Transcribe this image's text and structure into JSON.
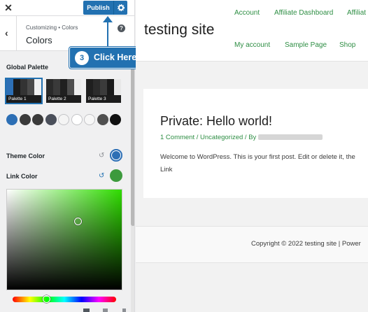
{
  "customizer": {
    "close_glyph": "✕",
    "publish_label": "Publish",
    "breadcrumb": "Customizing • Colors",
    "section_title": "Colors",
    "help_glyph": "?",
    "back_icon": "chevron-left-icon",
    "global_palette_label": "Global Palette",
    "palettes": [
      {
        "name": "Palette 1",
        "colors": [
          "#2d6fb5",
          "#1b1b1b",
          "#333333",
          "#4a4a4a",
          "#f0f0f0"
        ]
      },
      {
        "name": "Palette 2",
        "colors": [
          "#2a2a2a",
          "#3a3a3a",
          "#202020",
          "#4d4d4d",
          "#ececec"
        ]
      },
      {
        "name": "Palette 3",
        "colors": [
          "#1f1f1f",
          "#2b2b2b",
          "#3b3b3b",
          "#1a1a1a",
          "#e8e8e8"
        ]
      }
    ],
    "swatches": [
      "#2d6fb5",
      "#3a3a3a",
      "#3a3a3a",
      "#4a4f5a",
      "#f4f4f4",
      "#ffffff",
      "#f7f7f7",
      "#505050",
      "#111111"
    ],
    "theme_color_label": "Theme Color",
    "theme_color": "#2d6fb5",
    "link_color_label": "Link Color",
    "link_color": "#3d9a3d",
    "picker_hue": "#2fdc00",
    "picker_handle": {
      "saturation": 0.62,
      "value": 0.68
    },
    "hue_fraction": 0.33,
    "reset_glyph": "↺"
  },
  "callout": {
    "step_number": "3",
    "text": "Click Here",
    "color": "#2271b1"
  },
  "preview": {
    "site_title": "testing site",
    "nav_row1": [
      "Account",
      "Affiliate Dashboard",
      "Affiliat"
    ],
    "nav_row2": [
      "My account",
      "Sample Page",
      "Shop"
    ],
    "post_title": "Private: Hello world!",
    "post_meta": "1 Comment / Uncategorized / By",
    "post_body_line1": "Welcome to WordPress. This is your first post. Edit or delete it, the",
    "post_body_line2": "Link",
    "copyright": "Copyright © 2022 testing site | Power",
    "link_color": "#2e8e44"
  }
}
